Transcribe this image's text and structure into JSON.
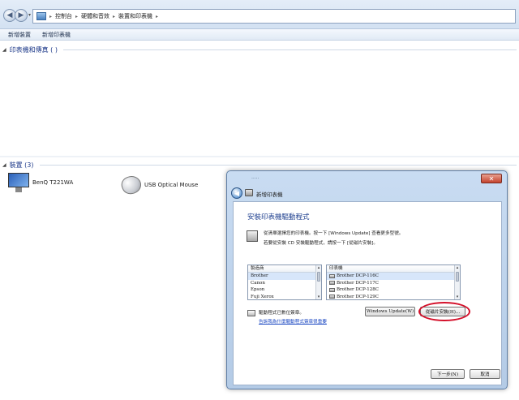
{
  "breadcrumb": {
    "items": [
      "控制台",
      "硬體和音效",
      "裝置和印表機"
    ]
  },
  "toolbar": {
    "add_device": "新增裝置",
    "add_printer": "新增印表機"
  },
  "sections": {
    "printers": {
      "title": "印表機和傳真 ( )"
    },
    "devices": {
      "title": "裝置 (3)"
    }
  },
  "devices": [
    {
      "name": "BenQ T221WA",
      "icon": "monitor-icon"
    },
    {
      "name": "USB Optical Mouse",
      "icon": "mouse-icon"
    }
  ],
  "dialog": {
    "window_title": "新增印表機",
    "heading": "安裝印表機驅動程式",
    "instruction_1": "從清單選擇您的印表機。按一下 [Windows Update] 查看更多型號。",
    "instruction_2": "若要從安裝 CD 安裝驅動程式，請按一下 [從磁片安裝]。",
    "manufacturer_header": "製造商",
    "manufacturers": [
      "Brother",
      "Canon",
      "Epson",
      "Fuji Xerox"
    ],
    "printer_header": "印表機",
    "printers": [
      "Brother DCP-116C",
      "Brother DCP-117C",
      "Brother DCP-128C",
      "Brother DCP-129C"
    ],
    "signed_text": "驅動程式已數位簽章。",
    "signing_link": "告訴我為什麼驅動程式簽章很重要",
    "windows_update_button": "Windows Update(W)",
    "have_disk_button": "從磁片安裝(H)...",
    "next_button": "下一步(N)",
    "cancel_button": "取消",
    "close_glyph": "✕"
  },
  "colors": {
    "heading": "#1e3f8f",
    "link": "#1a47c2",
    "highlight": "#d4102a"
  }
}
